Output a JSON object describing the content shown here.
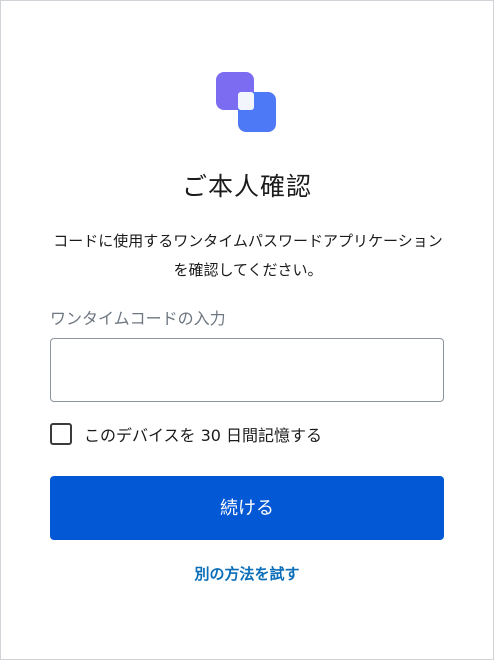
{
  "logo": {
    "icon": "brand-logo-icon",
    "colors": {
      "primary": "#4d79f7",
      "secondary": "#7b6cf2"
    }
  },
  "title": "ご本人確認",
  "description": "コードに使用するワンタイムパスワードアプリケーションを確認してください。",
  "otp": {
    "label": "ワンタイムコードの入力",
    "value": "",
    "placeholder": ""
  },
  "remember_device": {
    "label": "このデバイスを 30 日間記憶する",
    "checked": false
  },
  "continue_button": {
    "label": "続ける",
    "color": "#0358d6"
  },
  "alternate_method_link": "別の方法を試す"
}
